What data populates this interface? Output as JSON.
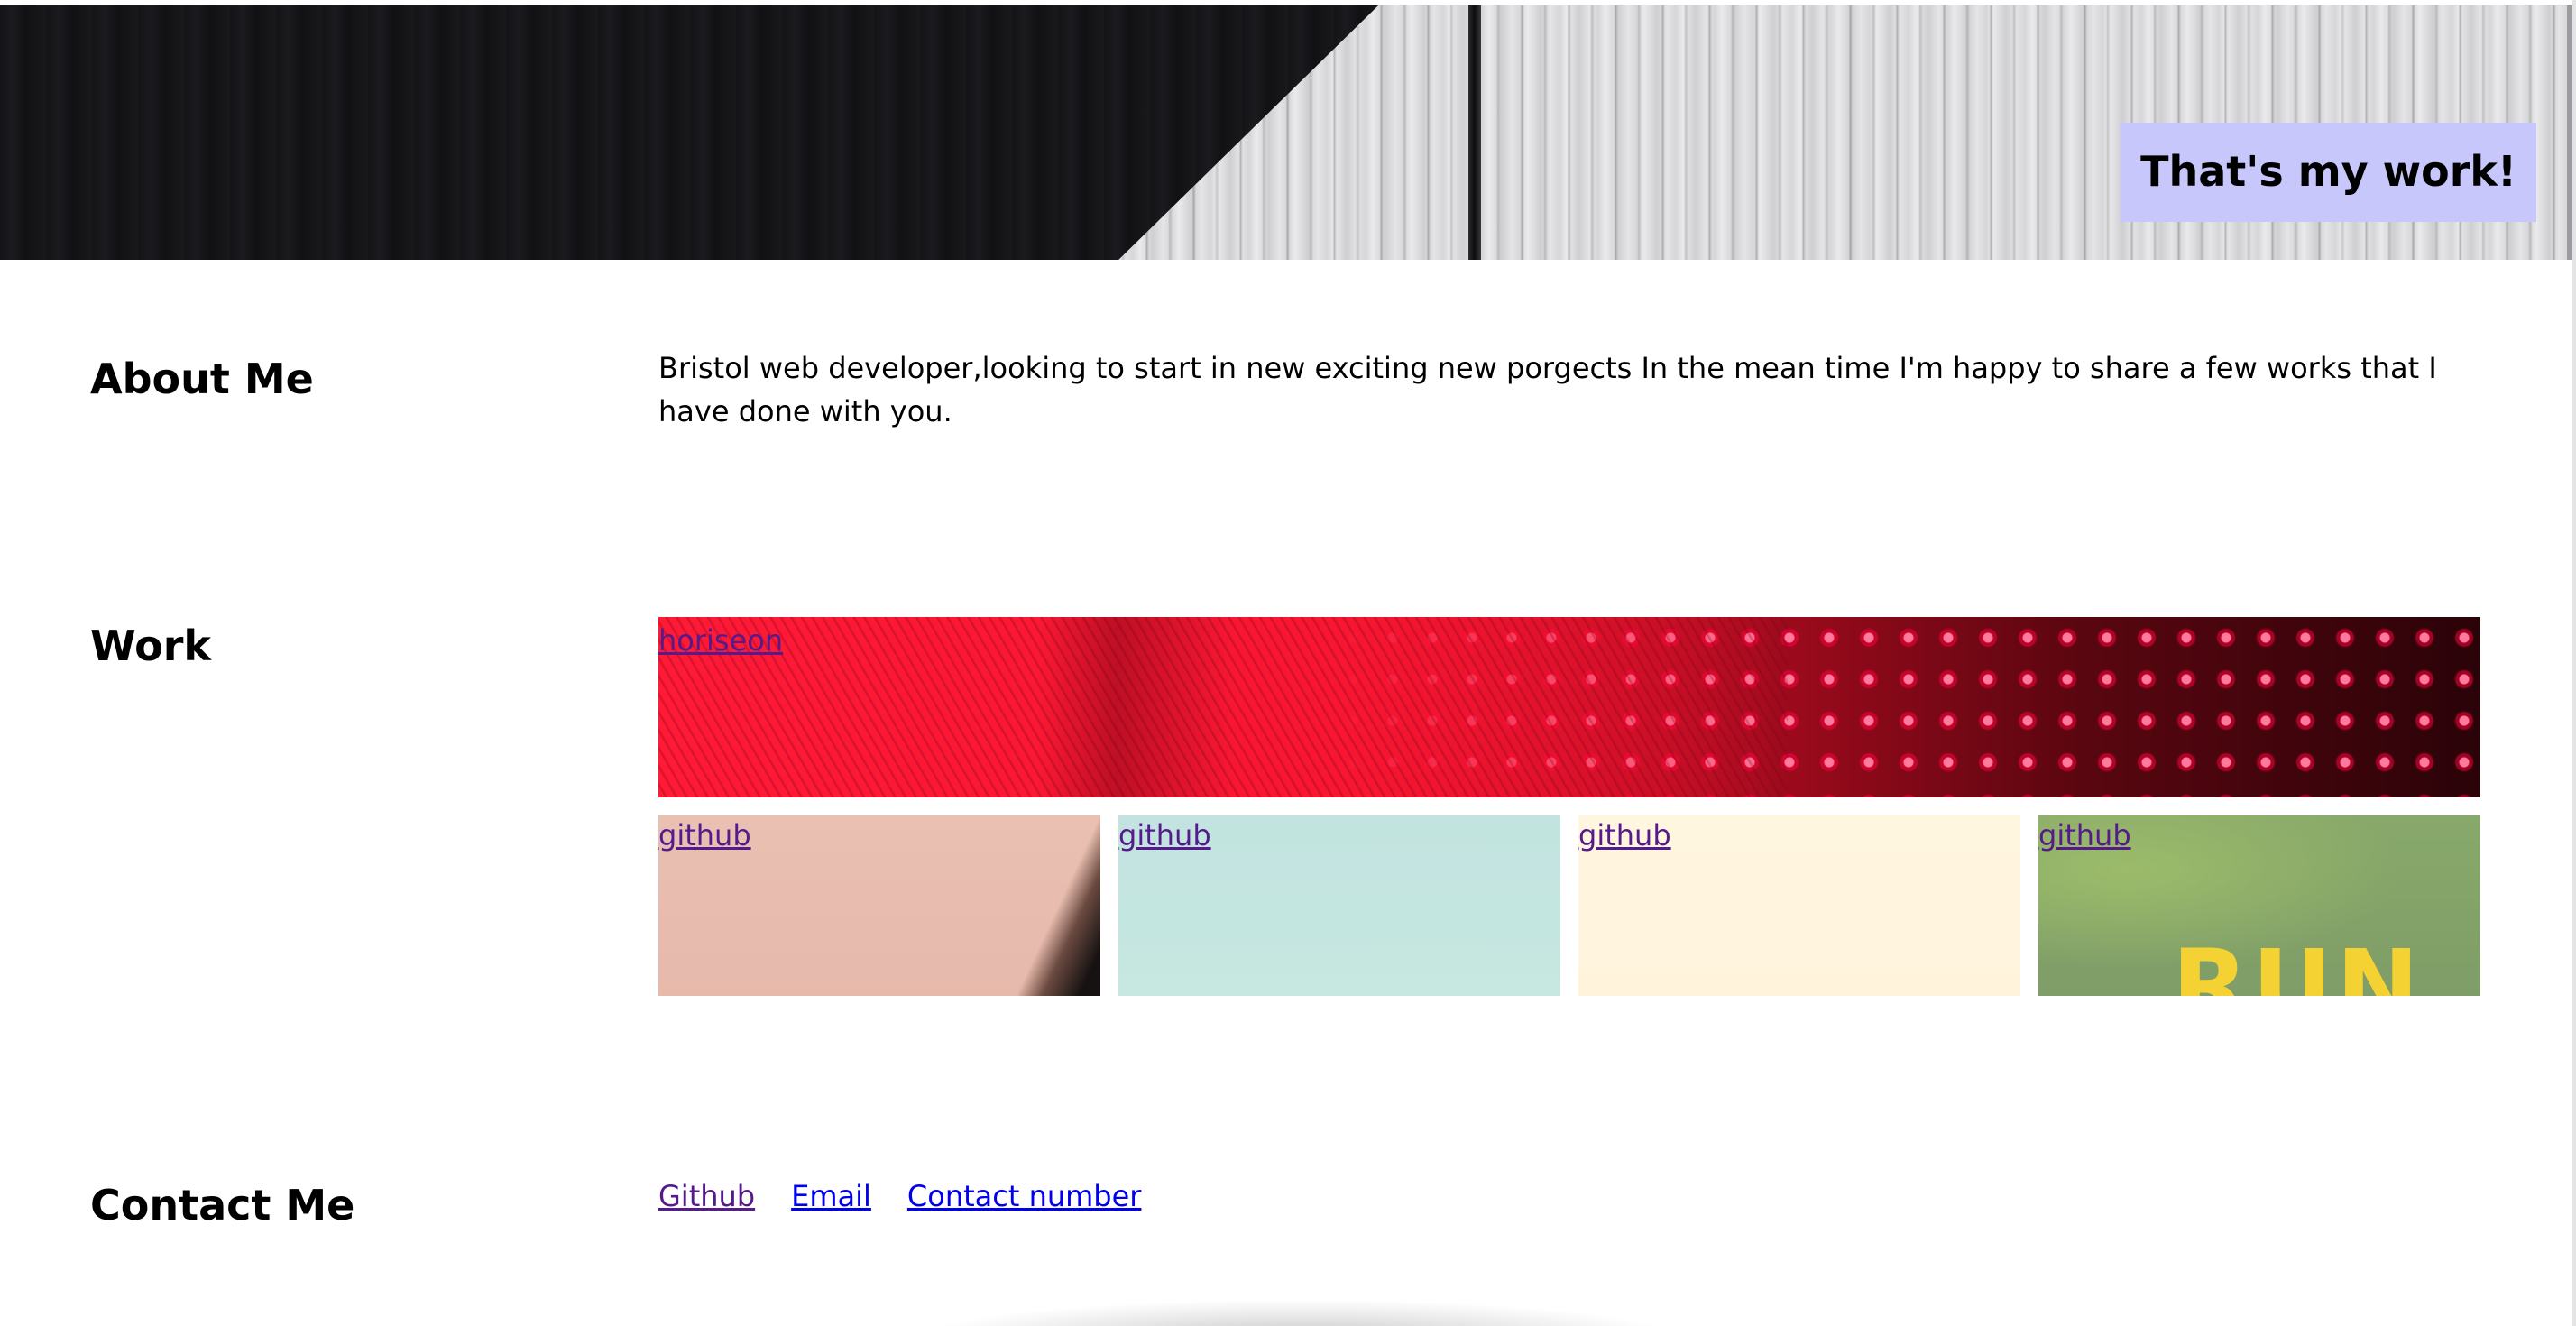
{
  "header": {
    "title": "That's my work!",
    "title_bg": "#c8c7fc"
  },
  "about": {
    "heading": "About Me",
    "text": "Bristol web developer,looking to start in new exciting new porgects In the mean time I'm happy to share a few works that I have done with you."
  },
  "work": {
    "heading": "Work",
    "featured": {
      "label": "horiseon",
      "image": "red-led-lights"
    },
    "tiles": [
      {
        "label": "github",
        "image": "pink-paper"
      },
      {
        "label": "github",
        "image": "mint-paper"
      },
      {
        "label": "github",
        "image": "cream-paper"
      },
      {
        "label": "github",
        "image": "green-run-sign",
        "overlay_text": "RUN"
      }
    ]
  },
  "contact": {
    "heading": "Contact Me",
    "links": [
      {
        "label": "Github",
        "state": "visited"
      },
      {
        "label": "Email",
        "state": "unvisited"
      },
      {
        "label": "Contact number",
        "state": "unvisited"
      }
    ]
  },
  "colors": {
    "visited_link": "#551a8b",
    "unvisited_link": "#0000ee"
  }
}
